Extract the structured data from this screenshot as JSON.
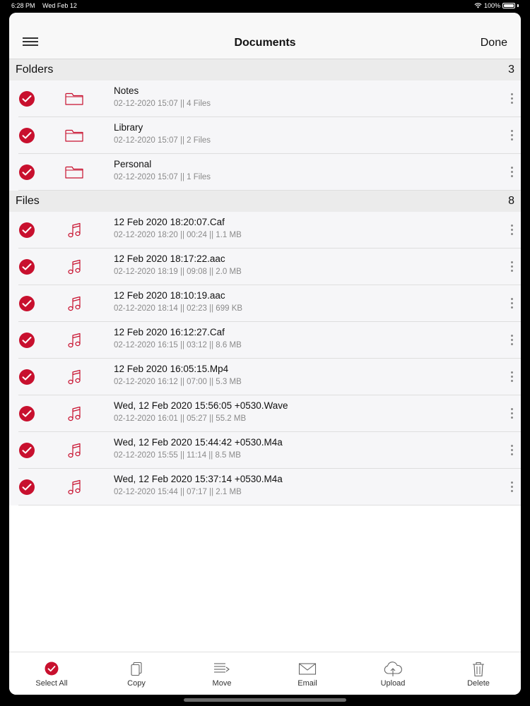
{
  "status_bar": {
    "time": "6:28 PM",
    "date": "Wed Feb 12",
    "battery": "100%"
  },
  "navbar": {
    "title": "Documents",
    "done_label": "Done"
  },
  "sections": {
    "folders": {
      "label": "Folders",
      "count": "3"
    },
    "files": {
      "label": "Files",
      "count": "8"
    }
  },
  "folders": [
    {
      "title": "Notes",
      "meta": "02-12-2020 15:07 || 4 Files",
      "icon": "folder-icon"
    },
    {
      "title": "Library",
      "meta": "02-12-2020 15:07 || 2 Files",
      "icon": "folder-icon"
    },
    {
      "title": "Personal",
      "meta": "02-12-2020 15:07 || 1 Files",
      "icon": "folder-icon"
    }
  ],
  "files": [
    {
      "title": "12 Feb 2020 18:20:07.Caf",
      "meta": "02-12-2020 18:20 || 00:24 || 1.1 MB",
      "icon": "music-note-icon"
    },
    {
      "title": "12 Feb 2020 18:17:22.aac",
      "meta": "02-12-2020 18:19 || 09:08 || 2.0 MB",
      "icon": "music-note-icon"
    },
    {
      "title": "12 Feb 2020 18:10:19.aac",
      "meta": "02-12-2020 18:14 || 02:23 || 699 KB",
      "icon": "music-note-icon"
    },
    {
      "title": "12 Feb 2020 16:12:27.Caf",
      "meta": "02-12-2020 16:15 || 03:12 || 8.6 MB",
      "icon": "music-note-icon"
    },
    {
      "title": "12 Feb 2020 16:05:15.Mp4",
      "meta": "02-12-2020 16:12 || 07:00 || 5.3 MB",
      "icon": "music-note-icon"
    },
    {
      "title": "Wed, 12 Feb 2020 15:56:05 +0530.Wave",
      "meta": "02-12-2020 16:01 || 05:27 || 55.2 MB",
      "icon": "music-note-icon"
    },
    {
      "title": "Wed, 12 Feb 2020 15:44:42 +0530.M4a",
      "meta": "02-12-2020 15:55 || 11:14 || 8.5 MB",
      "icon": "music-note-icon"
    },
    {
      "title": "Wed, 12 Feb 2020 15:37:14 +0530.M4a",
      "meta": "02-12-2020 15:44 || 07:17 || 2.1 MB",
      "icon": "music-note-icon"
    }
  ],
  "toolbar": {
    "select_all": "Select All",
    "copy": "Copy",
    "move": "Move",
    "email": "Email",
    "upload": "Upload",
    "delete": "Delete"
  },
  "colors": {
    "accent": "#c8102e",
    "row_bg": "#f6f6f8",
    "section_bg": "#ebebeb"
  }
}
